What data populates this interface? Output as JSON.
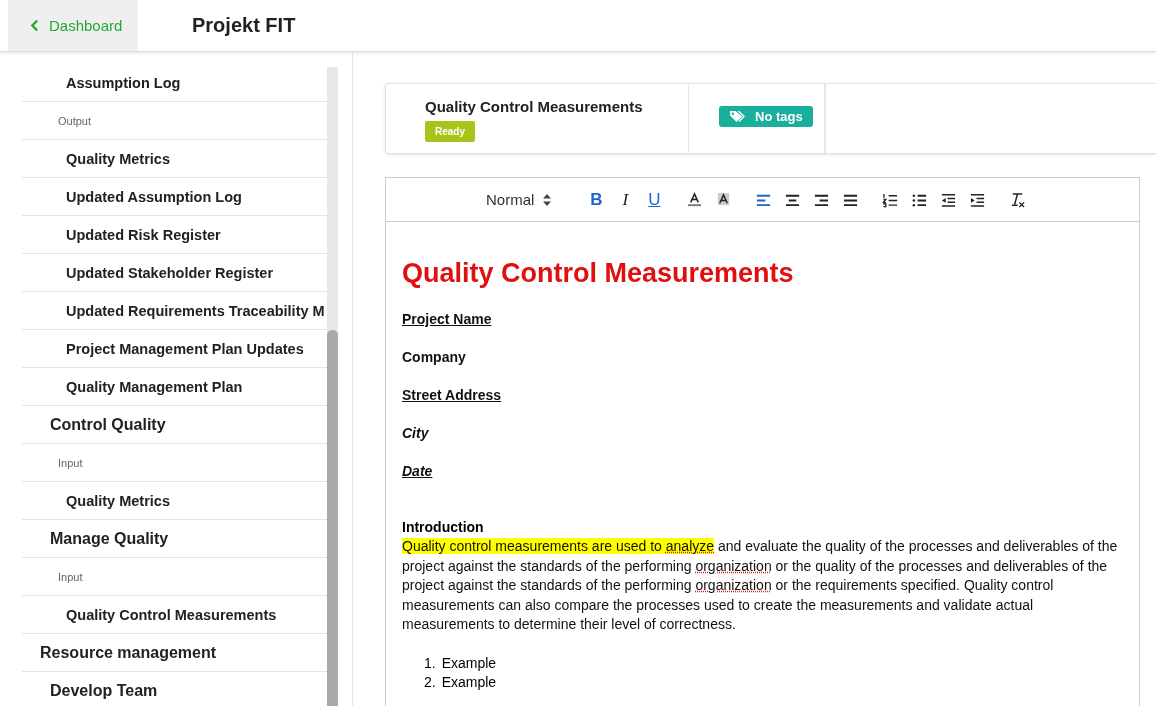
{
  "header": {
    "back_button": "Dashboard",
    "title": "Projekt FIT"
  },
  "sidebar": {
    "items": [
      {
        "label": "Assumption Log",
        "kind": "document"
      },
      {
        "label": "Output",
        "kind": "group",
        "children": [
          {
            "label": "Quality Metrics",
            "kind": "document"
          },
          {
            "label": "Updated Assumption Log",
            "kind": "document"
          },
          {
            "label": "Updated Risk Register",
            "kind": "document"
          },
          {
            "label": "Updated Stakeholder Register",
            "kind": "document"
          },
          {
            "label": "Updated Requirements Traceability M",
            "kind": "document"
          },
          {
            "label": "Project Management Plan Updates",
            "kind": "document"
          },
          {
            "label": "Quality Management Plan",
            "kind": "document"
          }
        ]
      },
      {
        "label": "Control Quality",
        "kind": "process",
        "children": [
          {
            "label": "Input",
            "kind": "group",
            "children": [
              {
                "label": "Quality Metrics",
                "kind": "document"
              }
            ]
          }
        ]
      },
      {
        "label": "Manage Quality",
        "kind": "process",
        "children": [
          {
            "label": "Input",
            "kind": "group",
            "children": [
              {
                "label": "Quality Control Measurements",
                "kind": "document"
              }
            ]
          }
        ]
      },
      {
        "label": "Resource management",
        "kind": "area",
        "children": [
          {
            "label": "Develop Team",
            "kind": "process"
          }
        ]
      }
    ]
  },
  "document_card": {
    "title": "Quality Control Measurements",
    "status": "Ready",
    "tags_button": "No tags"
  },
  "toolbar": [
    {
      "kind": "select",
      "label": "Normal"
    },
    {
      "kind": "bold",
      "label": "B",
      "active": true
    },
    {
      "kind": "italic",
      "label": "I",
      "active": false
    },
    {
      "kind": "underline",
      "label": "U",
      "active": true
    },
    {
      "kind": "color",
      "active": false
    },
    {
      "kind": "background",
      "active": false
    },
    {
      "kind": "align-left",
      "active": true
    },
    {
      "kind": "align-center",
      "active": false
    },
    {
      "kind": "align-right",
      "active": false
    },
    {
      "kind": "justify",
      "active": false
    },
    {
      "kind": "ordered-list",
      "active": false
    },
    {
      "kind": "bullet-list",
      "active": false
    },
    {
      "kind": "outdent",
      "active": false
    },
    {
      "kind": "indent",
      "active": false
    },
    {
      "kind": "clear",
      "active": false
    }
  ],
  "document": {
    "heading": "Quality Control Measurements",
    "fields": [
      {
        "text": "Project Name",
        "underline": true,
        "italic": false
      },
      {
        "text": "Company",
        "underline": false,
        "italic": false
      },
      {
        "text": "Street Address",
        "underline": true,
        "italic": false
      },
      {
        "text": "City",
        "underline": false,
        "italic": true
      },
      {
        "text": "Date",
        "underline": true,
        "italic": true
      }
    ],
    "section_title": "Introduction",
    "paragraph": [
      {
        "text": "Quality control measurements are used to ",
        "highlighted": true,
        "misspelled": false
      },
      {
        "text": "analyze",
        "highlighted": true,
        "misspelled": true
      },
      {
        "text": " and evaluate the quality of the processes and deliverables of the project against the standards of the performing ",
        "highlighted": false,
        "misspelled": false
      },
      {
        "text": "organization",
        "highlighted": false,
        "misspelled": true
      },
      {
        "text": " or the quality of the processes and deliverables of the project against the standards of the performing ",
        "highlighted": false,
        "misspelled": false
      },
      {
        "text": "organization",
        "highlighted": false,
        "misspelled": true
      },
      {
        "text": " or the requirements specified. Quality control measurements can also compare the processes used to create the measurements and validate actual measurements to determine their level of correctness.",
        "highlighted": false,
        "misspelled": false
      }
    ],
    "list": [
      {
        "number": "1.",
        "text": "Example"
      },
      {
        "number": "2.",
        "text": "Example"
      }
    ]
  }
}
